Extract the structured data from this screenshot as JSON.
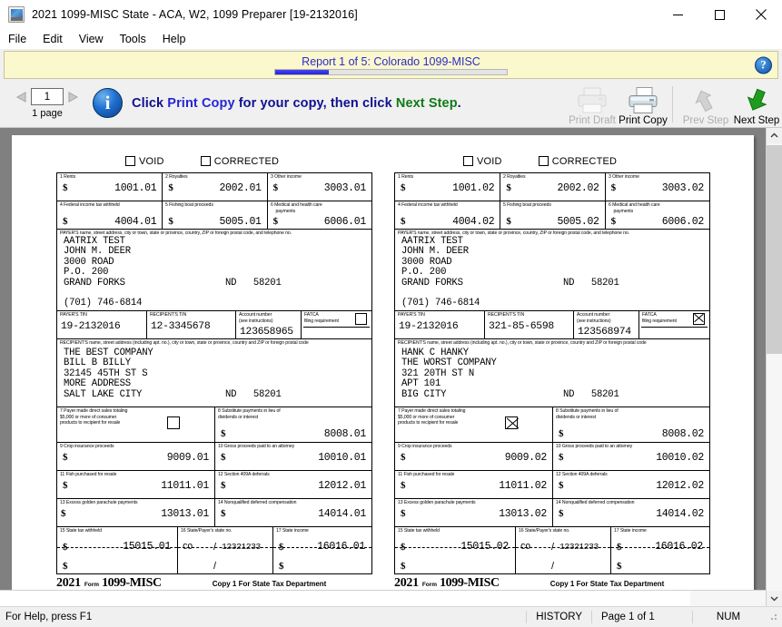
{
  "window": {
    "title": "2021 1099-MISC State - ACA, W2, 1099 Preparer [19-2132016]",
    "icon": "aatrix-app-icon",
    "minimize": "minimize-icon",
    "maximize": "maximize-icon",
    "close": "close-icon"
  },
  "menu": {
    "items": [
      "File",
      "Edit",
      "View",
      "Tools",
      "Help"
    ]
  },
  "banner": {
    "title": "Report 1 of 5: Colorado 1099-MISC",
    "progress_percent": 23,
    "help_glyph": "?"
  },
  "toolbar": {
    "prev_page_icon": "triangle-left-icon",
    "next_page_icon": "triangle-right-icon",
    "page_value": "1",
    "page_count_label": "1 page",
    "info_glyph": "i",
    "hint_prefix": "Click ",
    "hint_action1": "Print Copy",
    "hint_middle": " for your copy, then click ",
    "hint_action2": "Next Step",
    "hint_suffix": ".",
    "print_draft_label": "Print Draft",
    "print_copy_label": "Print Copy",
    "prev_step_label": "Prev Step",
    "next_step_label": "Next Step"
  },
  "statusbar": {
    "help_text": "For Help, press F1",
    "history": "HISTORY",
    "page": "Page 1 of 1",
    "num": "NUM"
  },
  "form_labels": {
    "void": "VOID",
    "corrected": "CORRECTED",
    "box1": "1  Rents",
    "box2": "2  Royalties",
    "box3": "3  Other income",
    "box4": "4   Federal income tax withheld",
    "box5": "5  Fishing boat proceeds",
    "box6": "6   Medical and health care",
    "box6b": "payments",
    "payer_caption": "PAYER'S name, street address, city or town, state or province, country, ZIP or foreign postal code, and telephone no.",
    "payer_tin": "PAYER'S TIN",
    "recipient_tin": "RECIPIENT'S TIN",
    "account_number": "Account number",
    "account_number2": "(see instructions)",
    "fatca": "FATCA",
    "fatca2": "filing  requirement",
    "recipient_caption": "RECIPIENT'S  name,  street  address  (including  apt. no.), city or town, state or province, country and ZIP or foreign postal code",
    "box7a": "7  Payer  made direct sales totaling",
    "box7b": "$5,000  or more of consumer",
    "box7c": " products  to recipient for resale",
    "box8a": "8 Substitute payments in lieu of",
    "box8b": "dividends or interest",
    "box9": "9  Crop insurance proceeds",
    "box10": "10   Gross proceeds paid to an attorney",
    "box11": "11  Fish purchased for resale",
    "box12": "12   Section 409A deferrals",
    "box13": "13  Excess golden parachute payments",
    "box14": "14 Nonqualified deferred compensation",
    "box15": "15   State tax withheld",
    "box16": "16   State/Payer's state no.",
    "box17": "17   State income",
    "year": "2021",
    "form_word": "Form",
    "form_number": "1099-MISC",
    "copy_text": "Copy 1   For State Tax Department",
    "slash": "/"
  },
  "forms": [
    {
      "name": "left-1099-misc-form",
      "void_checked": false,
      "corrected_checked": false,
      "box1": "1001.01",
      "box2": "2002.01",
      "box3": "3003.01",
      "box4": "4004.01",
      "box5": "5005.01",
      "box6": "6006.01",
      "payer_address": "AATRIX TEST\nJOHN M. DEER\n3000 ROAD\nP.O. 200\nGRAND FORKS",
      "payer_state": "ND",
      "payer_zip": "58201",
      "payer_phone": "(701) 746-6814",
      "payer_tin": "19-2132016",
      "recipient_tin": "12-3345678",
      "account_number": "123658965",
      "fatca_checked": false,
      "recipient_address": "THE BEST COMPANY\nBILL B BILLY\n32145 45TH ST S\nMORE ADDRESS\nSALT LAKE CITY",
      "recipient_state": "ND",
      "recipient_zip": "58201",
      "box7_checked": false,
      "box8": "8008.01",
      "box9": "9009.01",
      "box10": "10010.01",
      "box11": "11011.01",
      "box12": "12012.01",
      "box13": "13013.01",
      "box14": "14014.01",
      "box15": "15015.01",
      "box16_state": "CO",
      "box16_no": "12321233",
      "box17": "16016.01"
    },
    {
      "name": "right-1099-misc-form",
      "void_checked": false,
      "corrected_checked": false,
      "box1": "1001.02",
      "box2": "2002.02",
      "box3": "3003.02",
      "box4": "4004.02",
      "box5": "5005.02",
      "box6": "6006.02",
      "payer_address": "AATRIX TEST\nJOHN M. DEER\n3000 ROAD\nP.O. 200\nGRAND FORKS",
      "payer_state": "ND",
      "payer_zip": "58201",
      "payer_phone": "(701) 746-6814",
      "payer_tin": "19-2132016",
      "recipient_tin": "321-85-6598",
      "account_number": "123568974",
      "fatca_checked": true,
      "recipient_address": "HANK C HANKY\nTHE WORST COMPANY\n321 20TH ST N\nAPT 101\nBIG CITY",
      "recipient_state": "ND",
      "recipient_zip": "58201",
      "box7_checked": true,
      "box8": "8008.02",
      "box9": "9009.02",
      "box10": "10010.02",
      "box11": "11011.02",
      "box12": "12012.02",
      "box13": "13013.02",
      "box14": "14014.02",
      "box15": "15015.02",
      "box16_state": "CO",
      "box16_no": "12321233",
      "box17": "16016.02"
    }
  ]
}
